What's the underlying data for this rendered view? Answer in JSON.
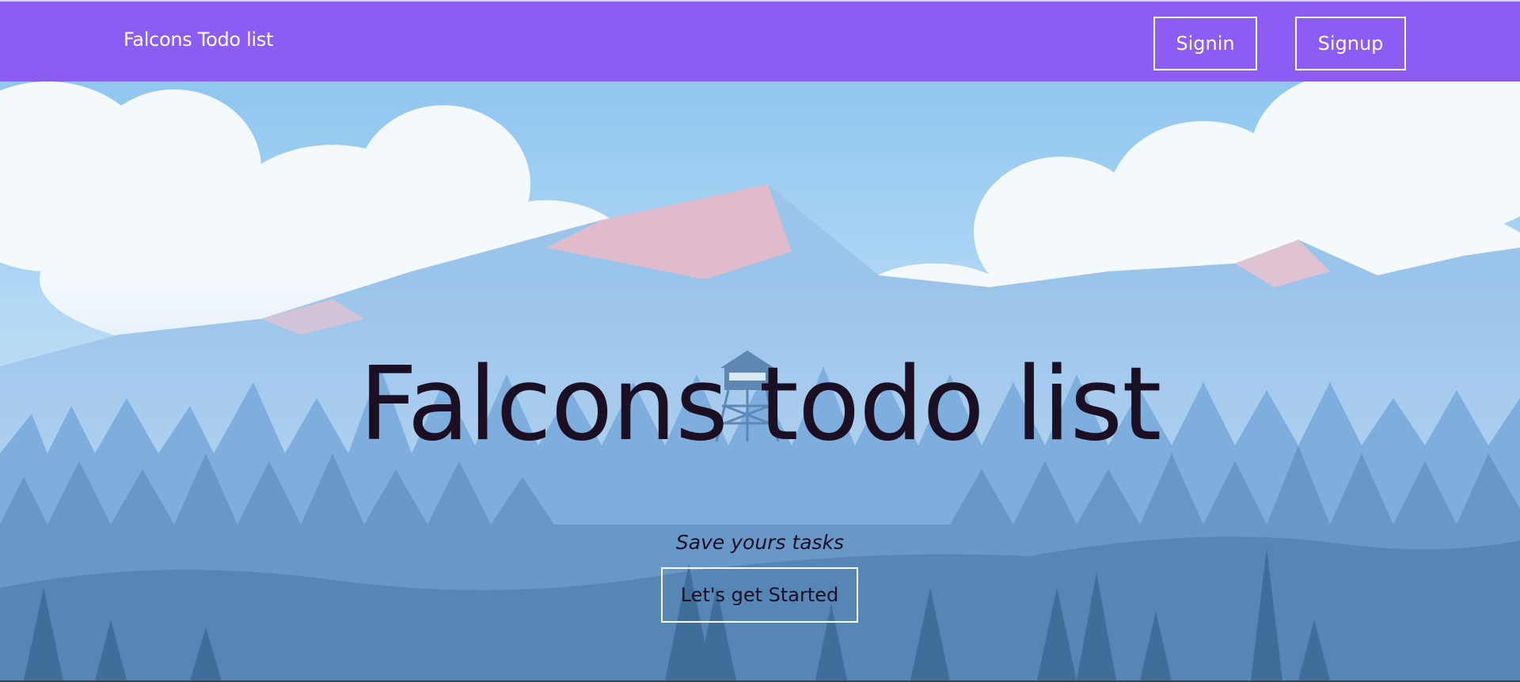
{
  "navbar": {
    "brand": "Falcons Todo list",
    "signin_label": "Signin",
    "signup_label": "Signup",
    "color": "#8c5cf5"
  },
  "hero": {
    "title": "Falcons todo list",
    "subtitle": "Save yours tasks",
    "cta_label": "Let's get Started",
    "background": "illustrated mountain landscape with pine forest and fire lookout tower",
    "text_color": "#1b0f24"
  }
}
